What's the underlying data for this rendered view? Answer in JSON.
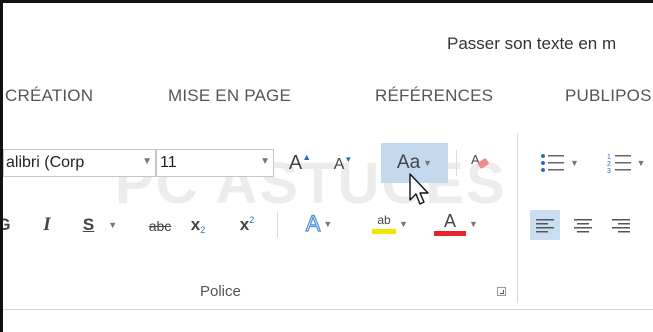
{
  "window": {
    "title": "Passer son texte en m"
  },
  "tabs": [
    "CRÉATION",
    "MISE EN PAGE",
    "RÉFÉRENCES",
    "PUBLIPOS"
  ],
  "font": {
    "name": "alibri (Corp",
    "size": "11"
  },
  "buttons": {
    "grow_font": "A",
    "shrink_font": "A",
    "change_case": "Aa",
    "italic": "I",
    "underline": "S",
    "strikethrough": "abc",
    "subscript": "x",
    "subscript_mark": "2",
    "superscript": "x",
    "superscript_mark": "2",
    "text_effects": "A",
    "highlight": "ab",
    "font_color": "A",
    "bold": "G"
  },
  "group": {
    "label": "Police"
  },
  "watermark": "PC ASTUCES",
  "colors": {
    "highlight": "#f2e600",
    "font_color": "#e8222a",
    "hover": "#c5d9ee",
    "effects": "#4a90d9"
  }
}
